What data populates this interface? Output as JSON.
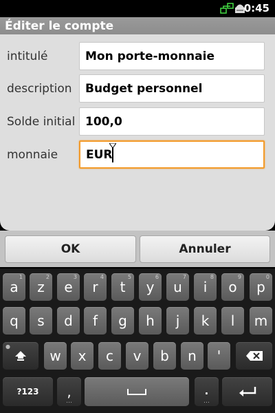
{
  "status": {
    "time": "0:45"
  },
  "dialog": {
    "title": "Éditer le compte",
    "fields": [
      {
        "label": "intitulé",
        "value": "Mon porte-monnaie"
      },
      {
        "label": "description",
        "value": "Budget personnel"
      },
      {
        "label": "Solde initial",
        "value": "100,0"
      },
      {
        "label": "monnaie",
        "value": "EUR"
      }
    ],
    "ok_label": "OK",
    "cancel_label": "Annuler"
  },
  "keyboard": {
    "row1": [
      "a",
      "z",
      "e",
      "r",
      "t",
      "y",
      "u",
      "i",
      "o",
      "p"
    ],
    "row1_hints": [
      "1",
      "2",
      "3",
      "4",
      "5",
      "6",
      "7",
      "8",
      "9",
      "0"
    ],
    "row2": [
      "q",
      "s",
      "d",
      "f",
      "g",
      "h",
      "j",
      "k",
      "l",
      "m"
    ],
    "row3": [
      "w",
      "x",
      "c",
      "v",
      "b",
      "n",
      "'"
    ],
    "sym_label": "?123",
    "comma": ",",
    "period": "."
  },
  "colors": {
    "focus_border": "#f39b2a",
    "dialog_bg": "#dedede",
    "keyboard_bg": "#1a1a1a"
  }
}
